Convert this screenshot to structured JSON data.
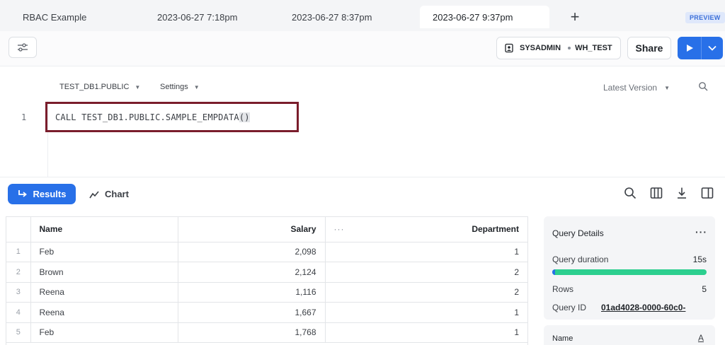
{
  "tabs": [
    {
      "label": "RBAC Example",
      "active": false
    },
    {
      "label": "2023-06-27 7:18pm",
      "active": false
    },
    {
      "label": "2023-06-27 8:37pm",
      "active": false
    },
    {
      "label": "2023-06-27 9:37pm",
      "active": true
    }
  ],
  "tab_add_label": "+",
  "preview_badge": "PREVIEW",
  "toolbar": {
    "role": "SYSADMIN",
    "warehouse": "WH_TEST",
    "share_label": "Share"
  },
  "editor": {
    "database_selector": "TEST_DB1.PUBLIC",
    "settings_label": "Settings",
    "version_label": "Latest Version",
    "line_number": "1",
    "code_text": "CALL TEST_DB1.PUBLIC.SAMPLE_EMPDATA",
    "code_parens": "()"
  },
  "results_bar": {
    "results_label": "Results",
    "chart_label": "Chart"
  },
  "table": {
    "columns": [
      "Name",
      "Salary",
      "Department"
    ],
    "column_menu": "···",
    "rows": [
      {
        "idx": "1",
        "name": "Feb",
        "salary": "2,098",
        "department": "1"
      },
      {
        "idx": "2",
        "name": "Brown",
        "salary": "2,124",
        "department": "2"
      },
      {
        "idx": "3",
        "name": "Reena",
        "salary": "1,116",
        "department": "2"
      },
      {
        "idx": "4",
        "name": "Reena",
        "salary": "1,667",
        "department": "1"
      },
      {
        "idx": "5",
        "name": "Feb",
        "salary": "1,768",
        "department": "1"
      }
    ]
  },
  "query_details": {
    "title": "Query Details",
    "more": "···",
    "duration_label": "Query duration",
    "duration_value": "15s",
    "rows_label": "Rows",
    "rows_value": "5",
    "query_id_label": "Query ID",
    "query_id_value": "01ad4028-0000-60c0-",
    "column_label": "Name",
    "column_type_icon": "A"
  },
  "colors": {
    "accent": "#2870e8",
    "highlight_box": "#7a1d2c",
    "progress": "#2ccf8f"
  },
  "icons": {
    "filter": "sliders-icon",
    "role": "id-badge-icon",
    "play": "play-icon",
    "dropdown": "chevron-down-icon",
    "search": "search-icon",
    "columns": "columns-icon",
    "download": "download-icon",
    "panel": "split-panel-icon",
    "results": "return-arrow-icon",
    "chart": "line-chart-icon"
  }
}
